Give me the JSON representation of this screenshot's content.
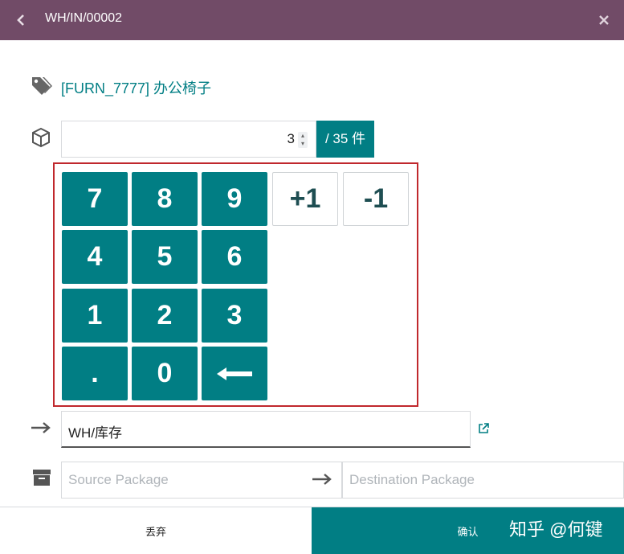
{
  "header": {
    "title": "WH/IN/00002",
    "back_icon": "chevron-left-icon",
    "close_icon": "close-icon"
  },
  "product": {
    "label": "[FURN_7777] 办公椅子",
    "icon": "tags-icon"
  },
  "quantity": {
    "value": "3",
    "total_label": "/ 35 件",
    "icon": "cube-icon"
  },
  "keypad": {
    "keys": [
      "7",
      "8",
      "9",
      "+1",
      "-1",
      "4",
      "5",
      "6",
      "1",
      "2",
      "3",
      ".",
      "0",
      "⟵"
    ]
  },
  "destination": {
    "location": "WH/库存",
    "arrow_icon": "arrow-right-icon",
    "link_icon": "external-link-icon"
  },
  "packages": {
    "source_placeholder": "Source Package",
    "destination_placeholder": "Destination Package",
    "icon": "archive-icon"
  },
  "footer": {
    "discard_label": "丢弃",
    "confirm_label": "确认"
  },
  "watermark": "知乎 @何键",
  "colors": {
    "header": "#714B67",
    "accent": "#017e84",
    "highlight_border": "#c0282d"
  }
}
